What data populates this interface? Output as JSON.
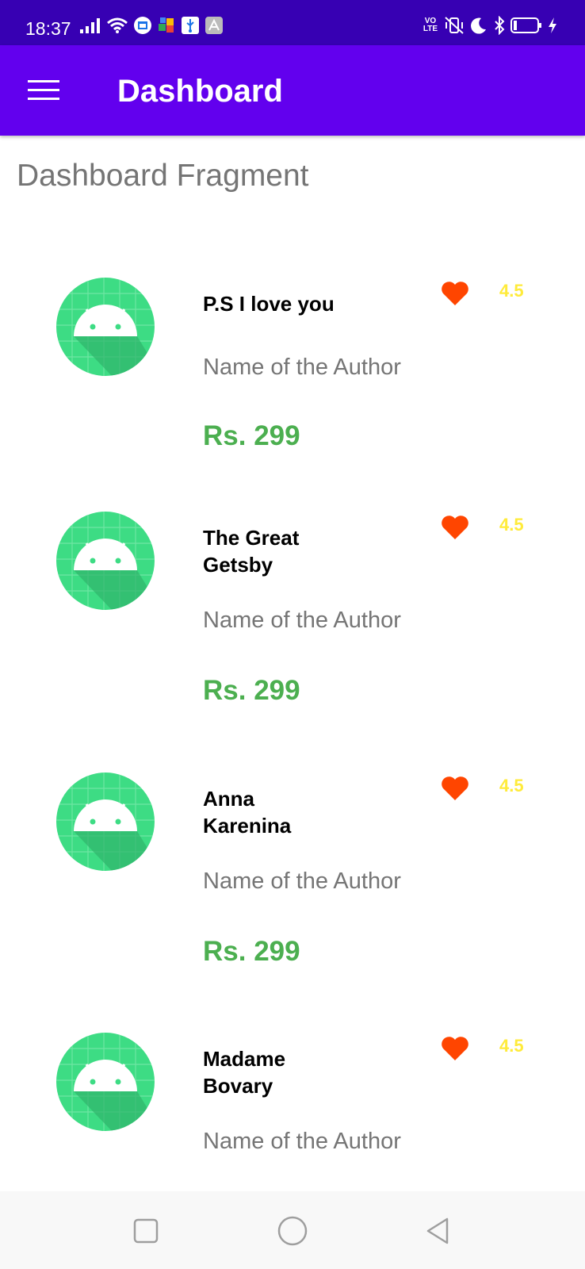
{
  "status_bar": {
    "time": "18:37",
    "left_icons": [
      "signal-icon",
      "wifi-icon",
      "calendar-icon",
      "puzzle-icon",
      "usb-icon",
      "store-icon"
    ],
    "right_icons": [
      "volte-icon",
      "vibrate-off-icon",
      "do-not-disturb-icon",
      "bluetooth-icon",
      "battery-icon",
      "charging-icon"
    ],
    "volte_label": "VO LTE"
  },
  "app_bar": {
    "title": "Dashboard",
    "menu_icon": "menu-icon"
  },
  "fragment_title": "Dashboard Fragment",
  "books": [
    {
      "title": "P.S I love you",
      "author": "Name of the Author",
      "price": "Rs. 299",
      "rating": "4.5"
    },
    {
      "title": "The Great Getsby",
      "author": "Name of the Author",
      "price": "Rs. 299",
      "rating": "4.5"
    },
    {
      "title": "Anna Karenina",
      "author": "Name of the Author",
      "price": "Rs. 299",
      "rating": "4.5"
    },
    {
      "title": "Madame Bovary",
      "author": "Name of the Author",
      "price": "Rs. 299",
      "rating": "4.5"
    }
  ],
  "colors": {
    "status_bar": "#3700b3",
    "app_bar": "#6200ee",
    "price": "#4caf50",
    "rating": "#ffeb3b",
    "heart": "#ff4500",
    "android_green": "#3ddc84"
  },
  "nav_bar": {
    "icons": [
      "recents-square-icon",
      "home-circle-icon",
      "back-triangle-icon"
    ]
  }
}
